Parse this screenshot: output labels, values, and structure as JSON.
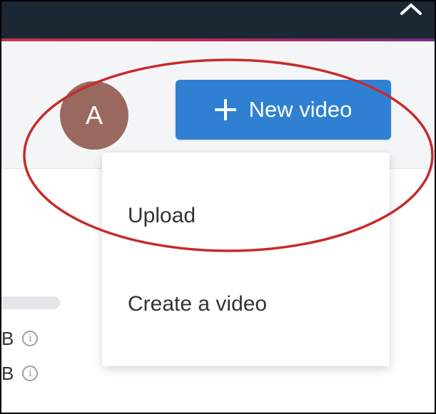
{
  "header": {
    "collapse_icon": "chevron-up-icon"
  },
  "user": {
    "avatar_initial": "A"
  },
  "new_video_button": {
    "label": "New video",
    "icon": "plus-icon"
  },
  "new_video_menu": {
    "items": [
      {
        "label": "Upload"
      },
      {
        "label": "Create a video"
      }
    ]
  },
  "storage": {
    "rows": [
      {
        "unit": "B",
        "icon": "info-icon"
      },
      {
        "unit": "B",
        "icon": "info-icon"
      }
    ]
  },
  "colors": {
    "topbar": "#1c2734",
    "accent_line": "#c9334c",
    "avatar": "#99695f",
    "primary_button": "#2f80d3",
    "annotation_circle": "#c62b2b"
  }
}
